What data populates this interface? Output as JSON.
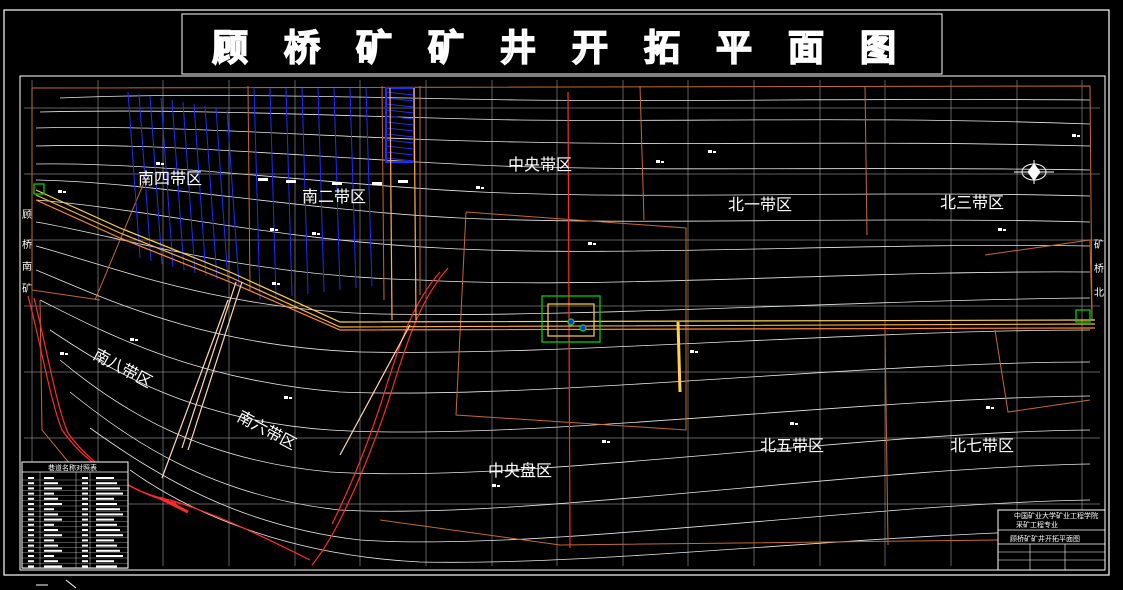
{
  "title": "顾桥矿矿井开拓平面图",
  "zones": {
    "nan_si": "南四带区",
    "nan_er": "南二带区",
    "zhong_yang_dai": "中央带区",
    "bei_yi": "北一带区",
    "bei_san": "北三带区",
    "nan_ba": "南八带区",
    "nan_liu": "南六带区",
    "zhong_yang_pan": "中央盘区",
    "bei_wu": "北五带区",
    "bei_qi": "北七带区"
  },
  "side_labels": {
    "left": [
      "顾",
      "桥",
      "南",
      "矿"
    ],
    "right": [
      "矿",
      "桥",
      "北"
    ]
  },
  "legend": {
    "title": "巷道名称对照表"
  },
  "title_block": {
    "school": "中国矿业大学矿业工程学院",
    "major": "采矿工程专业",
    "drawing": "顾桥矿矿井开拓平面图"
  },
  "compass_icon": "north-arrow-icon",
  "colors": {
    "background": "#000000",
    "frame": "#ffffff",
    "contour": "#ffffff",
    "boundary": "#c46a2a",
    "roadway": "#ffd24a",
    "fault": "#ff2a2a",
    "panel": "#1e2cff",
    "shaft": "#00e000"
  }
}
